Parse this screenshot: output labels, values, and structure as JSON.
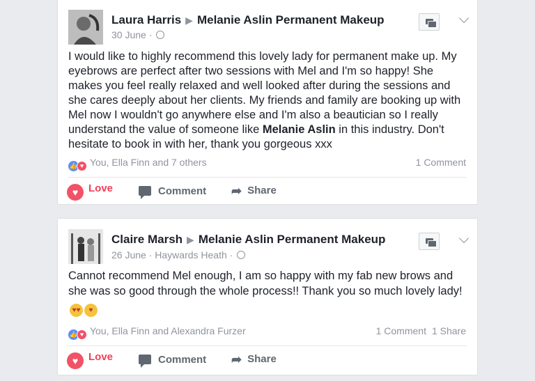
{
  "posts": [
    {
      "author": "Laura Harris",
      "page": "Melanie Aslin Permanent Makeup",
      "date": "30 June",
      "location": "",
      "text_before": "I would like to highly recommend this lovely lady for permanent make up. My eyebrows are perfect after two sessions with Mel and I'm so happy! She makes you feel really relaxed and well looked after during the sessions and she cares deeply about her clients. My friends and family are booking up with Mel now I wouldn't go anywhere else and I'm also a beautician so I really understand the value of someone like ",
      "text_bold": "Melanie Aslin",
      "text_after": " in this industry. Don't hesitate to book in with her, thank you gorgeous xxx",
      "reactions": "You, Ella Finn and 7 others",
      "comments": "1 Comment",
      "shares": "",
      "actions": {
        "love": "Love",
        "comment": "Comment",
        "share": "Share"
      }
    },
    {
      "author": "Claire Marsh",
      "page": "Melanie Aslin Permanent Makeup",
      "date": "26 June",
      "location": "Haywards Heath",
      "text": "Cannot recommend Mel enough, I am so happy with my fab new brows and she was so good through the whole process!! Thank you so much lovely lady!",
      "emojis": [
        "heart-eyes-emoji",
        "kiss-emoji"
      ],
      "reactions": "You, Ella Finn and Alexandra Furzer",
      "comments": "1 Comment",
      "shares": "1 Share",
      "actions": {
        "love": "Love",
        "comment": "Comment",
        "share": "Share"
      }
    }
  ],
  "icons": [
    "globe-icon",
    "message-icon",
    "chevron-down-icon",
    "like-reaction-icon",
    "love-reaction-icon",
    "heart-icon",
    "comment-icon",
    "share-icon"
  ],
  "colors": {
    "background": "#e9ebee",
    "love": "#f33e58",
    "like": "#5890ff",
    "meta": "#90949c"
  }
}
